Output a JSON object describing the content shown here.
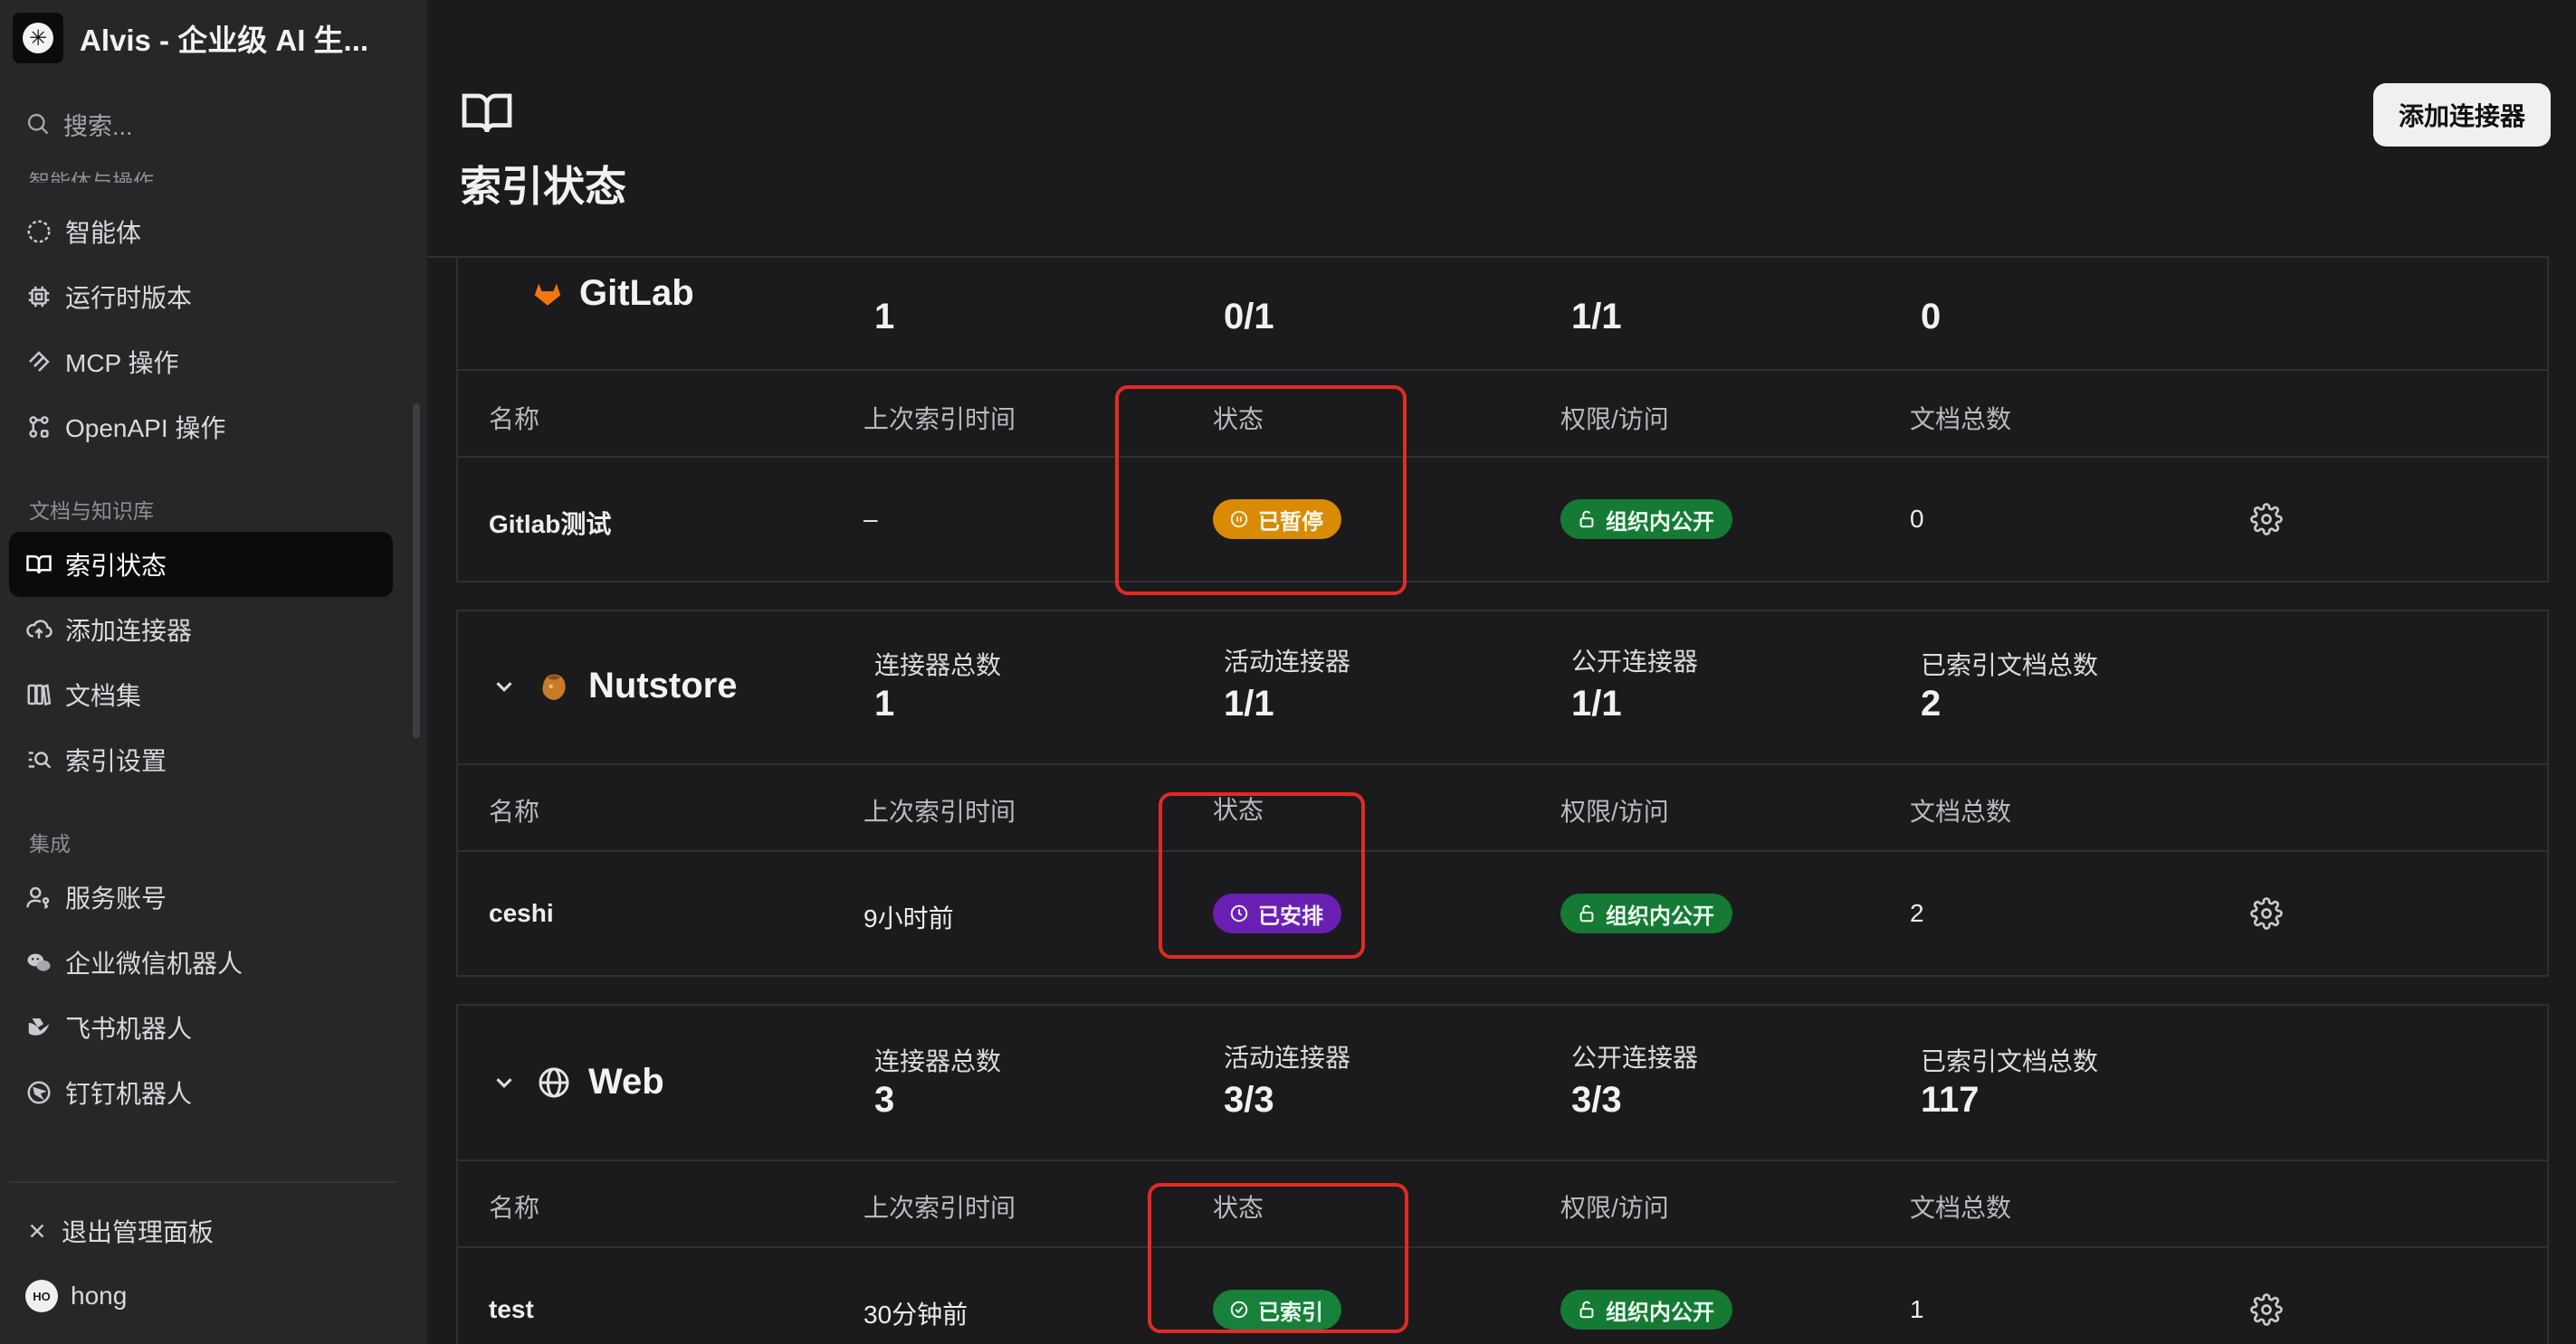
{
  "app": {
    "title": "Alvis - 企业级 AI 生...",
    "logo_glyph": "✳"
  },
  "sidebar": {
    "search_placeholder": "搜索...",
    "sections": [
      {
        "label": "智能体与操作",
        "items": [
          {
            "label": "智能体",
            "icon": "agent-icon"
          },
          {
            "label": "运行时版本",
            "icon": "cpu-icon"
          },
          {
            "label": "MCP 操作",
            "icon": "mcp-icon"
          },
          {
            "label": "OpenAPI 操作",
            "icon": "openapi-icon"
          }
        ]
      },
      {
        "label": "文档与知识库",
        "items": [
          {
            "label": "索引状态",
            "icon": "book-icon",
            "active": true
          },
          {
            "label": "添加连接器",
            "icon": "cloud-upload-icon"
          },
          {
            "label": "文档集",
            "icon": "document-set-icon"
          },
          {
            "label": "索引设置",
            "icon": "search-settings-icon"
          }
        ]
      },
      {
        "label": "集成",
        "items": [
          {
            "label": "服务账号",
            "icon": "user-key-icon"
          },
          {
            "label": "企业微信机器人",
            "icon": "wechat-icon"
          },
          {
            "label": "飞书机器人",
            "icon": "feishu-icon"
          },
          {
            "label": "钉钉机器人",
            "icon": "dingtalk-icon"
          }
        ]
      }
    ],
    "exit_label": "退出管理面板",
    "user": {
      "initials": "HO",
      "name": "hong"
    }
  },
  "page": {
    "title": "索引状态",
    "add_connector_label": "添加连接器"
  },
  "columns": {
    "name": "名称",
    "last_indexed": "上次索引时间",
    "status": "状态",
    "access": "权限/访问",
    "doc_count": "文档总数"
  },
  "summary_labels": {
    "total": "连接器总数",
    "active": "活动连接器",
    "public": "公开连接器",
    "indexed_docs": "已索引文档总数"
  },
  "groups": [
    {
      "name": "GitLab",
      "summary": {
        "total": "1",
        "active": "0/1",
        "public": "1/1",
        "indexed_docs": "0"
      },
      "row": {
        "name": "Gitlab测试",
        "last_indexed": "–",
        "status": "已暂停",
        "access": "组织内公开",
        "doc_count": "0"
      }
    },
    {
      "name": "Nutstore",
      "summary": {
        "total": "1",
        "active": "1/1",
        "public": "1/1",
        "indexed_docs": "2"
      },
      "row": {
        "name": "ceshi",
        "last_indexed": "9小时前",
        "status": "已安排",
        "access": "组织内公开",
        "doc_count": "2"
      }
    },
    {
      "name": "Web",
      "summary": {
        "total": "3",
        "active": "3/3",
        "public": "3/3",
        "indexed_docs": "117"
      },
      "row": {
        "name": "test",
        "last_indexed": "30分钟前",
        "status": "已索引",
        "access": "组织内公开",
        "doc_count": "1"
      }
    }
  ],
  "colors": {
    "status_paused": "#d98b06",
    "status_scheduled": "#6a1fb3",
    "status_indexed": "#17813b",
    "access_public": "#157a34",
    "annotation": "#e12b25"
  }
}
